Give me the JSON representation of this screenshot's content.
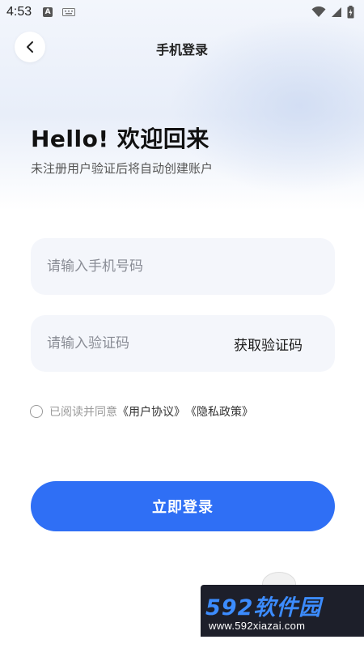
{
  "status_bar": {
    "time": "4:53",
    "a_label": "A"
  },
  "nav": {
    "title": "手机登录"
  },
  "hero": {
    "title": "Hello! 欢迎回来",
    "subtitle": "未注册用户验证后将自动创建账户"
  },
  "form": {
    "phone": {
      "placeholder": "请输入手机号码",
      "value": ""
    },
    "code": {
      "placeholder": "请输入验证码",
      "value": "",
      "get_code_label": "获取验证码"
    }
  },
  "agreement": {
    "checked": false,
    "prefix": "已阅读并同意",
    "user_agreement": "《用户协议》",
    "privacy_policy": "《隐私政策》"
  },
  "login": {
    "label": "立即登录",
    "color": "#2f6ff5"
  },
  "watermark": {
    "brand": "592软件园",
    "url": "www.592xiazai.com"
  }
}
